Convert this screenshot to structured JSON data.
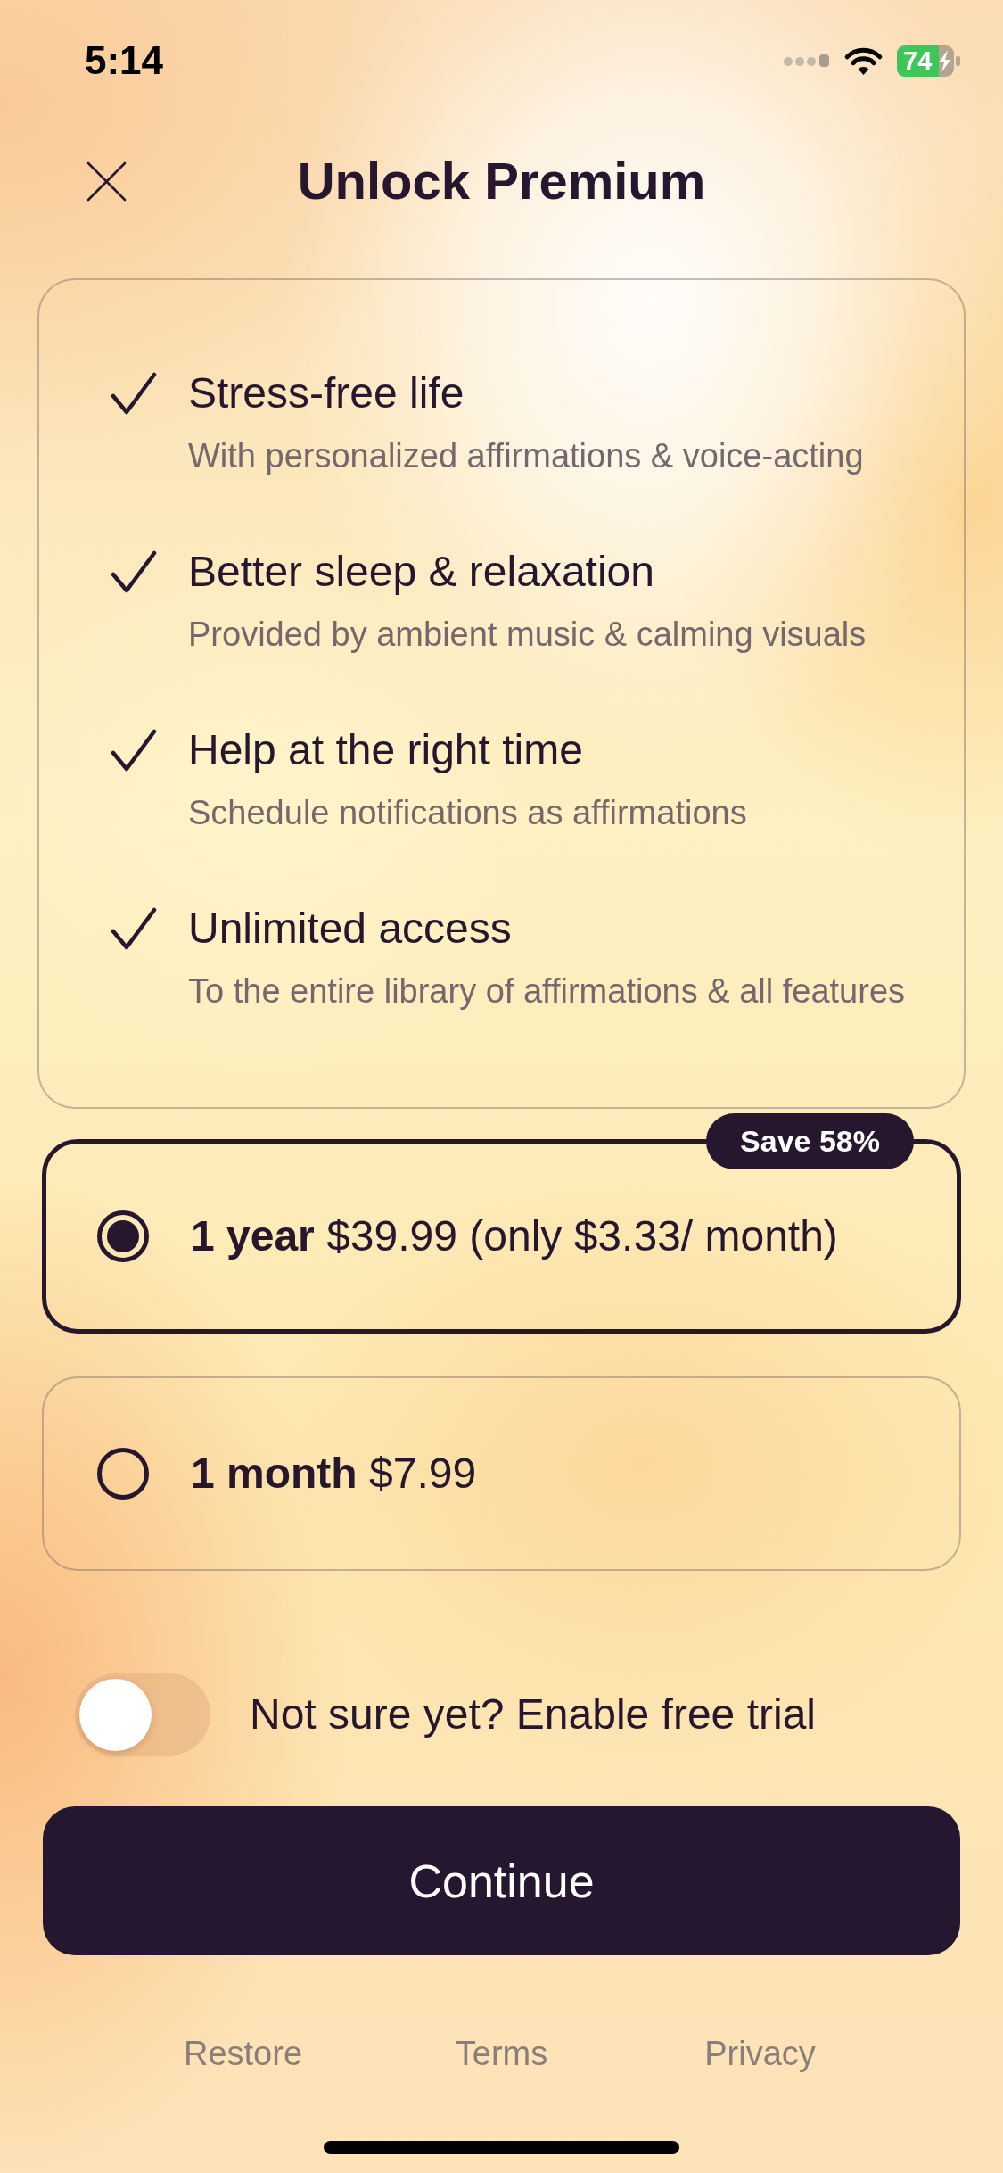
{
  "status_bar": {
    "time": "5:14",
    "battery": "74"
  },
  "header": {
    "title": "Unlock Premium"
  },
  "features": [
    {
      "title": "Stress-free life",
      "subtitle": "With personalized affirmations & voice-acting"
    },
    {
      "title": "Better sleep & relaxation",
      "subtitle": "Provided by ambient music & calming visuals"
    },
    {
      "title": "Help at the right time",
      "subtitle": "Schedule notifications as affirmations"
    },
    {
      "title": "Unlimited access",
      "subtitle": "To the entire library of affirmations & all features"
    }
  ],
  "plans": [
    {
      "label": "**1 year** $39.99 (only $3.33/ month)",
      "badge": "Save 58%",
      "selected": true
    },
    {
      "label": "**1 month** $7.99",
      "selected": false
    }
  ],
  "trial_toggle": {
    "label": "Not sure yet? Enable free trial",
    "on": false
  },
  "continue_button": {
    "label": "Continue"
  },
  "footer_links": [
    "Restore",
    "Terms",
    "Privacy"
  ]
}
